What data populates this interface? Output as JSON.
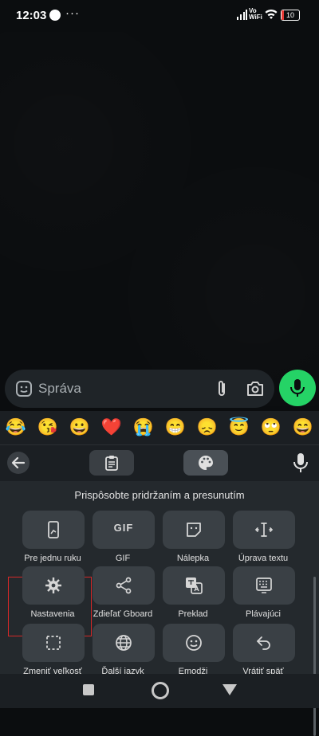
{
  "status_bar": {
    "time": "12:03",
    "dots": "···",
    "vowifi_top": "Vo",
    "vowifi_bottom": "WiFi",
    "battery": "10"
  },
  "composer": {
    "placeholder": "Správa"
  },
  "keyboard": {
    "emoji_suggestions": [
      "😂",
      "😘",
      "😀",
      "❤️",
      "😭",
      "😁",
      "😞",
      "😇",
      "🙄",
      "😄"
    ],
    "hint": "Prispôsobte pridržaním a presunutím",
    "gif_label": "GIF",
    "tiles": [
      {
        "label": "Pre jednu ruku",
        "icon": "one-hand-icon"
      },
      {
        "label": "GIF",
        "icon": "gif-icon"
      },
      {
        "label": "Nálepka",
        "icon": "sticker-icon"
      },
      {
        "label": "Úprava textu",
        "icon": "text-edit-icon"
      },
      {
        "label": "Nastavenia",
        "icon": "gear-icon"
      },
      {
        "label": "Zdieľať Gboard",
        "icon": "share-icon"
      },
      {
        "label": "Preklad",
        "icon": "translate-icon"
      },
      {
        "label": "Plávajúci",
        "icon": "floating-keyboard-icon"
      },
      {
        "label": "Zmeniť veľkosť",
        "icon": "resize-icon"
      },
      {
        "label": "Ďalší jazyk",
        "icon": "globe-icon"
      },
      {
        "label": "Emodži",
        "icon": "emoji-icon"
      },
      {
        "label": "Vrátiť späť",
        "icon": "undo-icon"
      }
    ]
  },
  "colors": {
    "accent_green": "#25d366",
    "highlight_red": "#d62828"
  }
}
